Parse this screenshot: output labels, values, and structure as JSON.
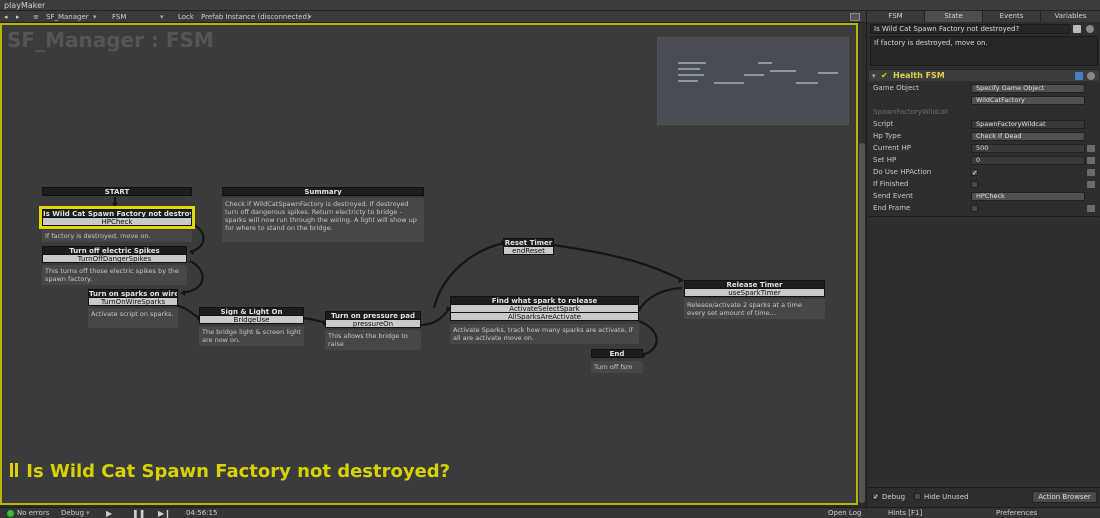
{
  "window": {
    "title": "playMaker"
  },
  "toolbar": {
    "nav_back": "◂",
    "nav_forward": "▸",
    "menu_glyph": "≡",
    "game_object": "SF_Manager",
    "fsm": "FSM",
    "lock": "Lock",
    "prefab_status": "Prefab Instance (disconnected)"
  },
  "graph": {
    "title": "SF_Manager : FSM",
    "selected_state_banner": "Is Wild Cat Spawn Factory not destroyed?"
  },
  "nodes": {
    "start": {
      "title": "START"
    },
    "summary": {
      "title": "Summary",
      "desc": "Check if WildCatSpawnFactory is destroyed. If destroyed turn off dangerous spikes. Return electricty to bridge - sparks will now run through the wiring. A light will show up for where to stand on the bridge."
    },
    "is_wild": {
      "title": "Is Wild Cat Spawn Factory not destroyed",
      "event": "HPCheck",
      "desc": "If factory is destroyed, move on."
    },
    "turn_off": {
      "title": "Turn off electric Spikes",
      "event": "TurnOffDangerSpikes",
      "desc": "This turns off those electric spikes by the spawn factory."
    },
    "sparks_on": {
      "title": "Turn on sparks on wire",
      "event": "TurnOnWireSparks",
      "desc": "Activate script on sparks."
    },
    "sign_light": {
      "title": "Sign & Light On",
      "event": "BridgeUse",
      "desc": "The bridge light & screen light are now on."
    },
    "pressure": {
      "title": "Turn on pressure pad",
      "event": "pressureOn",
      "desc": "This allows the bridge to raise"
    },
    "reset_timer": {
      "title": "Reset Timer",
      "event": "endReset"
    },
    "find_spark": {
      "title": "Find what spark to release",
      "event": "ActivateSelectSpark",
      "event2": "AllSparksAreActivate",
      "desc": "Activate Sparks, track how many sparks are activate, if all are activate move on."
    },
    "release_timer": {
      "title": "Release Timer",
      "event": "useSparkTimer",
      "desc": "Release/activate 2 sparks at a time every set amount of time..."
    },
    "end": {
      "title": "End",
      "desc": "Turn off fsm"
    }
  },
  "status": {
    "errors": "No errors",
    "debug": "Debug",
    "time": "04:56:15",
    "open_log": "Open Log",
    "hints": "Hints [F1]",
    "preferences": "Preferences"
  },
  "inspector": {
    "tabs": [
      "FSM",
      "State",
      "Events",
      "Variables"
    ],
    "active_tab": "State",
    "state_name": "Is Wild Cat Spawn Factory not destroyed?",
    "state_description": "If factory is destroyed, move on.",
    "action": {
      "name": "Health FSM",
      "game_object_label": "Game Object",
      "game_object_mode": "Specify Game Object",
      "game_object_value": "WildCatFactory",
      "section": "SpawnFactoryWildcat",
      "fields": [
        {
          "label": "Script",
          "value": "SpawnFactoryWildcat"
        },
        {
          "label": "Hp Type",
          "value": "Check If Dead"
        },
        {
          "label": "Current HP",
          "value": "500"
        },
        {
          "label": "Set HP",
          "value": "0"
        },
        {
          "label": "Do Use HPAction",
          "check": "✓"
        },
        {
          "label": "If Finished",
          "check": ""
        },
        {
          "label": "Send Event",
          "value": "HPCheck"
        },
        {
          "label": "End Frame",
          "check": ""
        }
      ]
    },
    "debug_label": "Debug",
    "debug_check": "✓",
    "hide_unused_label": "Hide Unused",
    "action_browser": "Action Browser"
  },
  "colors": {
    "selection": "#e2d900",
    "border": "#b8b400",
    "action_title": "#e0d24a"
  }
}
